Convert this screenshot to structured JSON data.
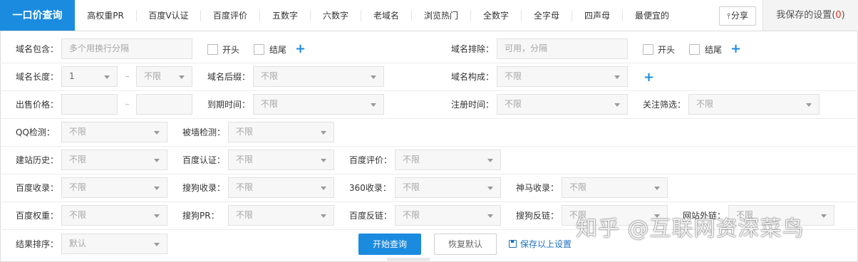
{
  "tabs": [
    {
      "label": "一口价查询",
      "active": true
    },
    {
      "label": "高权重PR"
    },
    {
      "label": "百度V认证"
    },
    {
      "label": "百度评价"
    },
    {
      "label": "五数字"
    },
    {
      "label": "六数字"
    },
    {
      "label": "老域名"
    },
    {
      "label": "浏览热门"
    },
    {
      "label": "全数字"
    },
    {
      "label": "全字母"
    },
    {
      "label": "四声母"
    },
    {
      "label": "最便宜的"
    }
  ],
  "share_label": "分享",
  "saved_settings": {
    "label": "我保存的设置(",
    "count": "0",
    "close": ")"
  },
  "filters": {
    "domain_include": {
      "label": "域名包含：",
      "placeholder": "多个用换行分隔"
    },
    "start_label": "开头",
    "end_label": "结尾",
    "domain_exclude": {
      "label": "域名排除：",
      "placeholder": "可用，分隔"
    },
    "domain_length": {
      "label": "域名长度：",
      "min": "1",
      "max": "不限"
    },
    "domain_suffix": {
      "label": "域名后缀：",
      "value": "不限"
    },
    "domain_composition": {
      "label": "域名构成：",
      "value": "不限"
    },
    "sale_price": {
      "label": "出售价格："
    },
    "expire_time": {
      "label": "到期时间：",
      "value": "不限"
    },
    "register_time": {
      "label": "注册时间：",
      "value": "不限"
    },
    "follow_filter": {
      "label": "关注筛选：",
      "value": "不限"
    },
    "qq_check": {
      "label": "QQ检测：",
      "value": "不限"
    },
    "wall_check": {
      "label": "被墙检测：",
      "value": "不限"
    },
    "site_history": {
      "label": "建站历史：",
      "value": "不限"
    },
    "baidu_cert": {
      "label": "百度认证：",
      "value": "不限"
    },
    "baidu_rating": {
      "label": "百度评价：",
      "value": "不限"
    },
    "baidu_index": {
      "label": "百度收录：",
      "value": "不限"
    },
    "sogou_index": {
      "label": "搜狗收录：",
      "value": "不限"
    },
    "s360_index": {
      "label": "360收录：",
      "value": "不限"
    },
    "shenma_index": {
      "label": "神马收录：",
      "value": "不限"
    },
    "baidu_weight": {
      "label": "百度权重：",
      "value": "不限"
    },
    "sogou_pr": {
      "label": "搜狗PR：",
      "value": "不限"
    },
    "baidu_backlink": {
      "label": "百度反链：",
      "value": "不限"
    },
    "sogou_backlink": {
      "label": "搜狗反链：",
      "value": "不限"
    },
    "external_links": {
      "label": "网站外链：",
      "value": "不限"
    },
    "sort": {
      "label": "结果排序：",
      "value": "默认"
    }
  },
  "actions": {
    "search": "开始查询",
    "reset": "恢复默认",
    "save": "保存以上设置"
  },
  "watermark": "知乎 @互联网资深菜鸟",
  "colors": {
    "accent": "#1b8be0",
    "count": "#e0301e"
  }
}
